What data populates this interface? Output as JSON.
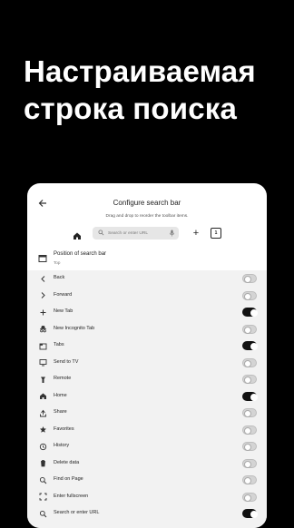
{
  "headline": {
    "line1": "Настраиваемая",
    "line2": "строка поиска"
  },
  "screen": {
    "title": "Configure search bar",
    "subtitle": "Drag and drop to reorder the toolbar items.",
    "toolbar_preview": {
      "search_placeholder": "Search or enter URL",
      "tab_count": "1"
    },
    "position": {
      "label": "Position of search bar",
      "value": "Top"
    },
    "items": [
      {
        "label": "Back",
        "icon": "chevron-left-icon",
        "enabled": false
      },
      {
        "label": "Forward",
        "icon": "chevron-right-icon",
        "enabled": false
      },
      {
        "label": "New Tab",
        "icon": "plus-icon",
        "enabled": true
      },
      {
        "label": "New Incognito Tab",
        "icon": "incognito-icon",
        "enabled": false
      },
      {
        "label": "Tabs",
        "icon": "tabs-icon",
        "enabled": true
      },
      {
        "label": "Send to TV",
        "icon": "cast-icon",
        "enabled": false
      },
      {
        "label": "Remote",
        "icon": "remote-icon",
        "enabled": false
      },
      {
        "label": "Home",
        "icon": "home-icon",
        "enabled": true
      },
      {
        "label": "Share",
        "icon": "share-icon",
        "enabled": false
      },
      {
        "label": "Favorites",
        "icon": "star-icon",
        "enabled": false
      },
      {
        "label": "History",
        "icon": "history-icon",
        "enabled": false
      },
      {
        "label": "Delete data",
        "icon": "trash-icon",
        "enabled": false
      },
      {
        "label": "Find on Page",
        "icon": "find-icon",
        "enabled": false
      },
      {
        "label": "Enter fullscreen",
        "icon": "fullscreen-icon",
        "enabled": false
      },
      {
        "label": "Search or enter URL",
        "icon": "search-icon",
        "enabled": true
      }
    ]
  }
}
